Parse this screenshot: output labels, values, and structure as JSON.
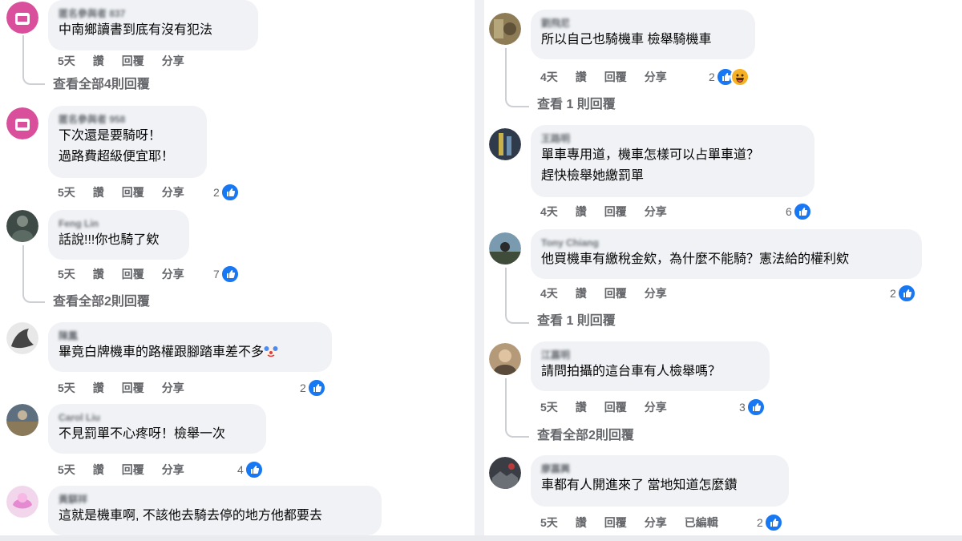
{
  "actions": {
    "time_5": "5天",
    "time_4": "4天",
    "like": "讚",
    "reply": "回覆",
    "share": "分享",
    "edited": "已編輯"
  },
  "left_comments": [
    {
      "name": "匿名參與者 837",
      "lines": [
        "中南鄉讀書到底有沒有犯法"
      ],
      "time": "5天",
      "reaction_count": "",
      "view_replies": "查看全部4則回覆",
      "avatar": "pink-anonymous-avatar"
    },
    {
      "name": "匿名參與者 958",
      "lines": [
        "下次還是要騎呀！",
        "過路費超級便宜耶！"
      ],
      "time": "5天",
      "reaction_count": "2",
      "view_replies": "",
      "avatar": "pink-anonymous-avatar"
    },
    {
      "name": "Feng Lin",
      "lines": [
        "話說!!!你也騎了欸"
      ],
      "time": "5天",
      "reaction_count": "7",
      "view_replies": "查看全部2則回覆",
      "avatar": "photo-avatar"
    },
    {
      "name": "陳鳳",
      "lines": [
        "畢竟白牌機車的路權跟腳踏車差不多"
      ],
      "time": "5天",
      "reaction_count": "2",
      "view_replies": "",
      "avatar": "photo-avatar",
      "emoji": "clown-face"
    },
    {
      "name": "Carol Liu",
      "lines": [
        "不見罰單不心疼呀！檢舉一次"
      ],
      "time": "5天",
      "reaction_count": "4",
      "view_replies": "",
      "avatar": "photo-avatar"
    },
    {
      "name": "黃騏祥",
      "lines": [
        "這就是機車啊, 不該他去騎去停的地方他都要去"
      ],
      "time": "",
      "reaction_count": "",
      "view_replies": "",
      "avatar": "pink-avatar"
    }
  ],
  "right_comments": [
    {
      "name": "劉飛尼",
      "lines": [
        "所以自己也騎機車 檢舉騎機車"
      ],
      "time": "4天",
      "reaction_count": "2",
      "haha": true,
      "view_replies": "查看 1 則回覆"
    },
    {
      "name": "王路明",
      "lines": [
        "單車專用道，機車怎樣可以占單車道？",
        "趕快檢舉她繳罰單"
      ],
      "time": "4天",
      "reaction_count": "6",
      "view_replies": ""
    },
    {
      "name": "Tony Chiang",
      "lines": [
        "他買機車有繳稅金欸，為什麼不能騎？憲法給的權利欸"
      ],
      "time": "4天",
      "reaction_count": "2",
      "view_replies": "查看 1 則回覆"
    },
    {
      "name": "江嘉明",
      "lines": [
        "請問拍攝的這台車有人檢舉嗎？"
      ],
      "time": "5天",
      "reaction_count": "3",
      "view_replies": "查看全部2則回覆"
    },
    {
      "name": "廖嘉興",
      "lines": [
        "車都有人開進來了 當地知道怎麼鑽"
      ],
      "time": "5天",
      "reaction_count": "2",
      "edited": true,
      "view_replies": ""
    }
  ],
  "colors": {
    "like_blue": "#1877f2",
    "bubble": "#f0f2f5",
    "meta_gray": "#65676b"
  }
}
